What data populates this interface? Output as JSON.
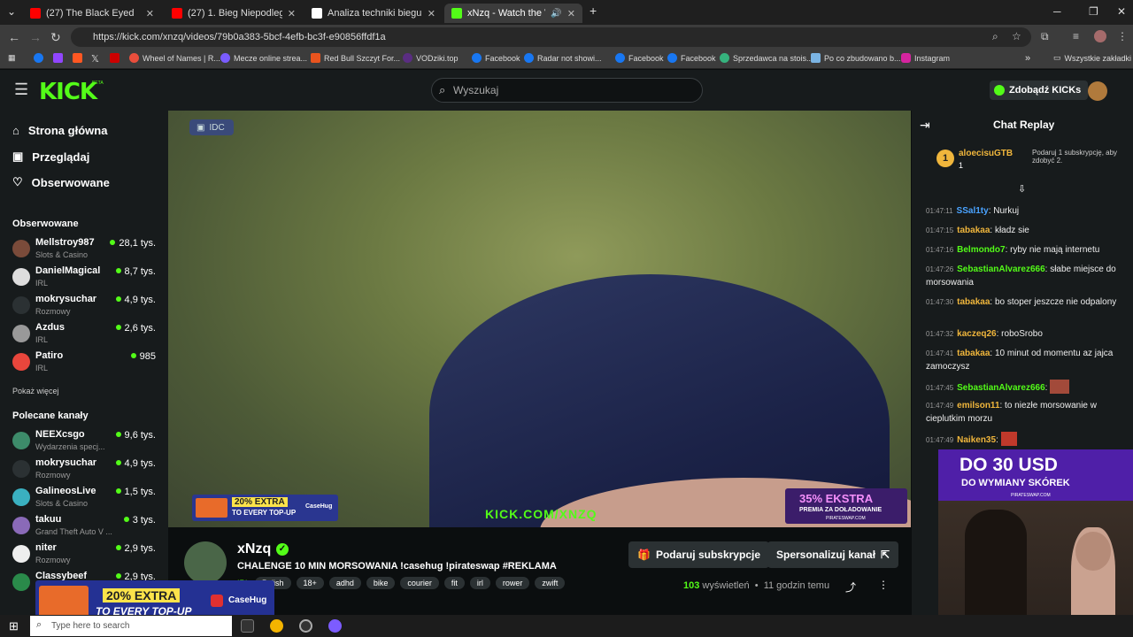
{
  "browser": {
    "tabs": [
      {
        "label": "(27) The Black Eyed Peas - I Got",
        "color": "#ff0000"
      },
      {
        "label": "(27) 1. Bieg Niepodległości Gdy",
        "color": "#ff0000"
      },
      {
        "label": "Analiza techniki biegu – ocena",
        "color": "#ffffff"
      },
      {
        "label": "xNzq - Watch the VOD on K",
        "color": "#53fc18"
      }
    ],
    "url": "https://kick.com/xnzq/videos/79b0a383-5bcf-4efb-bc3f-e90856ffdf1a",
    "bookmarks": [
      "Wheel of Names | R...",
      "Mecze online strea...",
      "Red Bull Szczyt For...",
      "VODziki.top",
      "Facebook",
      "Radar not showi...",
      "Facebook",
      "Facebook",
      "Sprzedawca na stois...",
      "Po co zbudowano b...",
      "Instagram"
    ],
    "all_bookmarks": "Wszystkie zakładki"
  },
  "header": {
    "logo": "KICK",
    "beta": "BETA",
    "search_placeholder": "Wyszukaj",
    "get_kicks": "Zdobądź KICKs"
  },
  "sidebar": {
    "nav": [
      {
        "label": "Strona główna",
        "icon": "home-icon",
        "glyph": "⌂"
      },
      {
        "label": "Przeglądaj",
        "icon": "browse-icon",
        "glyph": "▣"
      },
      {
        "label": "Obserwowane",
        "icon": "heart-icon",
        "glyph": "♡"
      }
    ],
    "followed_title": "Obserwowane",
    "followed": [
      {
        "name": "Mellstroy987",
        "category": "Slots & Casino",
        "viewers": "28,1 tys.",
        "color": "#7a4b3a"
      },
      {
        "name": "DanielMagical",
        "category": "IRL",
        "viewers": "8,7 tys.",
        "color": "#dddddd"
      },
      {
        "name": "mokrysuchar",
        "category": "Rozmowy",
        "viewers": "4,9 tys.",
        "color": "#2b3133"
      },
      {
        "name": "Azdus",
        "category": "IRL",
        "viewers": "2,6 tys.",
        "color": "#999999"
      },
      {
        "name": "Patiro",
        "category": "IRL",
        "viewers": "985",
        "color": "#e8463c"
      }
    ],
    "show_more": "Pokaż więcej",
    "recommended_title": "Polecane kanały",
    "recommended": [
      {
        "name": "NEEXcsgo",
        "category": "Wydarzenia specj...",
        "viewers": "9,6 tys.",
        "color": "#3d8b6a"
      },
      {
        "name": "mokrysuchar",
        "category": "Rozmowy",
        "viewers": "4,9 tys.",
        "color": "#2b3133"
      },
      {
        "name": "GalineosLive",
        "category": "Slots & Casino",
        "viewers": "1,5 tys.",
        "color": "#3ab0c0"
      },
      {
        "name": "takuu",
        "category": "Grand Theft Auto V ...",
        "viewers": "3 tys.",
        "color": "#8a6ab8"
      },
      {
        "name": "niter",
        "category": "Rozmowy",
        "viewers": "2,9 tys.",
        "color": "#eeeeee"
      },
      {
        "name": "Classybeef",
        "category": "",
        "viewers": "2,9 tys.",
        "color": "#2a8a4a"
      }
    ]
  },
  "video": {
    "badge": "IDC",
    "watermark": "KICK.COM/XNZQ",
    "banner_left": {
      "highlight": "20% EXTRA",
      "sub": "TO EVERY TOP-UP",
      "brand": "CaseHug"
    },
    "banner_right": {
      "highlight": "35% EKSTRA",
      "sub": "PREMIA ZA DOŁADOWANIE",
      "site": "PIRATESWAP.COM"
    }
  },
  "stream": {
    "channel": "xNzq",
    "title": "CHALENGE 10 MIN MORSOWANIA !casehug !pirateswap #REKLAMA",
    "category": "IRL",
    "tags": [
      "Polish",
      "18+",
      "adhd",
      "bike",
      "courier",
      "fit",
      "irl",
      "rower",
      "zwift"
    ],
    "gift_sub": "Podaruj subskrypcje",
    "customize": "Spersonalizuj kanał",
    "views_count": "103",
    "views_label": "wyświetleń",
    "time_ago": "11 godzin temu"
  },
  "chat": {
    "title": "Chat Replay",
    "pinned_user": "aloecisuGTB",
    "pinned_count": "1",
    "pinned_text": "Podaruj 1 subskrypcję, aby zdobyć 2.",
    "messages": [
      {
        "time": "01:47:11",
        "user": "SSal1ty",
        "text": ": Nurkuj",
        "color": "#4aa3ff"
      },
      {
        "time": "01:47:15",
        "user": "tabakaa",
        "text": ": kładz sie",
        "color": "#f0b63c"
      },
      {
        "time": "01:47:16",
        "user": "Belmondo7",
        "text": ": ryby nie mają internetu",
        "color": "#53fc18"
      },
      {
        "time": "01:47:26",
        "user": "SebastianAlvarez666",
        "text": ": słabe miejsce do morsowania",
        "color": "#53fc18"
      },
      {
        "time": "01:47:30",
        "user": "tabakaa",
        "text": ": bo stoper jeszcze nie odpalony",
        "color": "#f0b63c"
      },
      {
        "time": "01:47:32",
        "user": "kaczeq26",
        "text": ": roboSrobo",
        "color": "#f0b63c"
      },
      {
        "time": "01:47:41",
        "user": "tabakaa",
        "text": ": 10 minut od momentu az jajca zamoczysz",
        "color": "#f0b63c"
      },
      {
        "time": "01:47:45",
        "user": "SebastianAlvarez666",
        "text": ":",
        "color": "#53fc18"
      },
      {
        "time": "01:47:49",
        "user": "emilson11",
        "text": ": to niezłe morsowanie w cieplutkim morzu",
        "color": "#f0b63c"
      },
      {
        "time": "01:47:49",
        "user": "Naiken35",
        "text": ":",
        "color": "#f0b63c"
      }
    ]
  },
  "chat_ad": {
    "title": "DO 30 USD",
    "sub": "DO WYMIANY SKÓREK",
    "site": "PIRATESWAP.COM"
  },
  "taskbar": {
    "search_placeholder": "Type here to search"
  }
}
